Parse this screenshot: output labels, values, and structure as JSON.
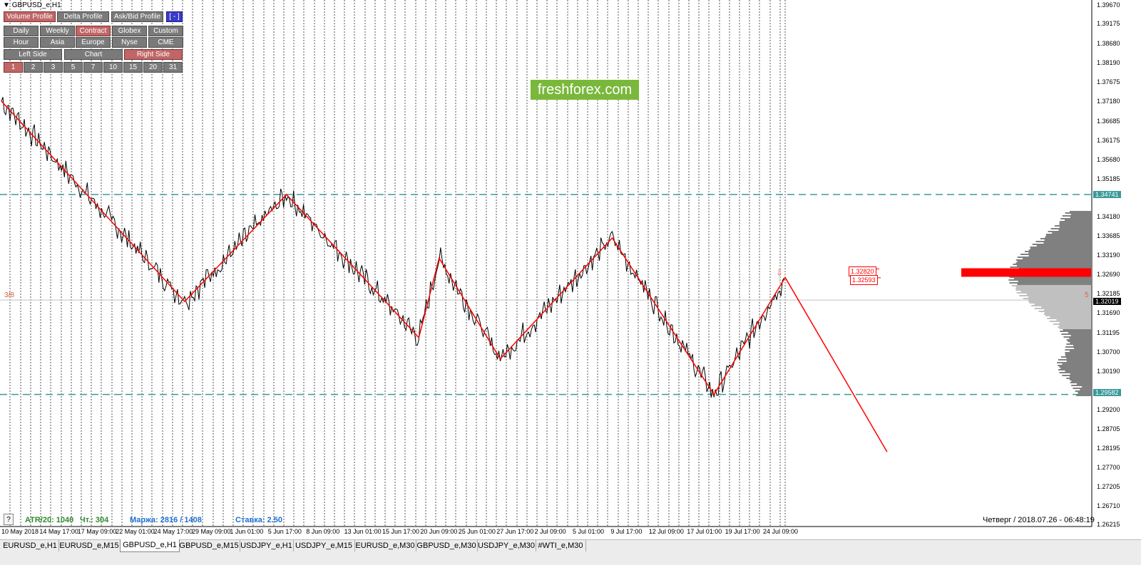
{
  "symbol_title": "GBPUSD_e,H1",
  "watermark": "freshforex.com",
  "panel": {
    "row1": [
      {
        "label": "Volume Profile",
        "state": "on"
      },
      {
        "label": "Delta Profile",
        "state": "off"
      },
      {
        "label": "Ask/Bid Profile",
        "state": "off"
      },
      {
        "label": "[ - ]",
        "state": "blue"
      }
    ],
    "row2": [
      {
        "label": "Daily",
        "state": "off"
      },
      {
        "label": "Weekly",
        "state": "off"
      },
      {
        "label": "Contract",
        "state": "on"
      },
      {
        "label": "Globex",
        "state": "off"
      },
      {
        "label": "Custom",
        "state": "off"
      }
    ],
    "row3": [
      {
        "label": "Hour",
        "state": "off"
      },
      {
        "label": "Asia",
        "state": "off"
      },
      {
        "label": "Europe",
        "state": "off"
      },
      {
        "label": "Nyse",
        "state": "off"
      },
      {
        "label": "CME",
        "state": "off"
      }
    ],
    "row4": [
      {
        "label": "Left Side",
        "state": "off"
      },
      {
        "label": "Chart",
        "state": "off"
      },
      {
        "label": "Right Side",
        "state": "on"
      }
    ],
    "row5": [
      {
        "label": "1",
        "state": "on"
      },
      {
        "label": "2",
        "state": "off"
      },
      {
        "label": "3",
        "state": "off"
      },
      {
        "label": "5",
        "state": "off"
      },
      {
        "label": "7",
        "state": "off"
      },
      {
        "label": "10",
        "state": "off"
      },
      {
        "label": "15",
        "state": "off"
      },
      {
        "label": "20",
        "state": "off"
      },
      {
        "label": "31",
        "state": "off"
      }
    ]
  },
  "stats": {
    "question": "?",
    "atr": "ATR/20: 1040",
    "ticks": "Чт.: 304",
    "margin": "Маржа: 2816 / 1408",
    "rate": "Ставка: 2.50"
  },
  "datetime": "Четверг / 2018.07.26 - 06:48:19",
  "labels": {
    "left_fraction": "3/8",
    "right_fraction": "5",
    "arrow": "⇩"
  },
  "level_tags": [
    "1.32820",
    "1.32593"
  ],
  "price_axis": [
    "1.39670",
    "1.39175",
    "1.38680",
    "1.38190",
    "1.37675",
    "1.37180",
    "1.36685",
    "1.36175",
    "1.35680",
    "1.35185",
    "1.34741",
    "1.34180",
    "1.33685",
    "1.33190",
    "1.32690",
    "1.32185",
    "1.32019",
    "1.31690",
    "1.31195",
    "1.30700",
    "1.30190",
    "1.29582",
    "1.29200",
    "1.28705",
    "1.28195",
    "1.27700",
    "1.27205",
    "1.26710",
    "1.26215"
  ],
  "highlight_prices": {
    "upper": "1.34741",
    "current": "1.32019",
    "lower": "1.29582"
  },
  "time_axis": [
    "10 May 2018",
    "14 May 17:00",
    "17 May 09:00",
    "22 May 01:00",
    "24 May 17:00",
    "29 May 09:00",
    "1 Jun 01:00",
    "5 Jun 17:00",
    "8 Jun 09:00",
    "13 Jun 01:00",
    "15 Jun 17:00",
    "20 Jun 09:00",
    "25 Jun 01:00",
    "27 Jun 17:00",
    "2 Jul 09:00",
    "5 Jul 01:00",
    "9 Jul 17:00",
    "12 Jul 09:00",
    "17 Jul 01:00",
    "19 Jul 17:00",
    "24 Jul 09:00"
  ],
  "tabs": [
    {
      "label": "EURUSD_e,H1",
      "active": false
    },
    {
      "label": "EURUSD_e,M15",
      "active": false
    },
    {
      "label": "GBPUSD_e,H1",
      "active": true
    },
    {
      "label": "GBPUSD_e,M15",
      "active": false
    },
    {
      "label": "USDJPY_e,H1",
      "active": false
    },
    {
      "label": "USDJPY_e,M15",
      "active": false
    },
    {
      "label": "EURUSD_e,M30",
      "active": false
    },
    {
      "label": "GBPUSD_e,M30",
      "active": false
    },
    {
      "label": "USDJPY_e,M30",
      "active": false
    },
    {
      "label": "#WTI_e,M30",
      "active": false
    }
  ],
  "colors": {
    "zigzag": "#ff0000",
    "level_dash": "#3a9a9a",
    "volume_profile": "#808080",
    "poc": "#ff0000",
    "atr_text": "#2e8b2e",
    "margin_text": "#1e6fd0",
    "tag_border": "#ff0000"
  },
  "chart_data": {
    "type": "line",
    "series": "GBPUSD_e,H1",
    "zigzag_pivots": [
      {
        "date": "2018-05-10",
        "price": 1.3715
      },
      {
        "date": "2018-05-28",
        "price": 1.3198
      },
      {
        "date": "2018-06-07",
        "price": 1.3474
      },
      {
        "date": "2018-06-20",
        "price": 1.3105
      },
      {
        "date": "2018-06-22",
        "price": 1.331
      },
      {
        "date": "2018-06-28",
        "price": 1.305
      },
      {
        "date": "2018-07-09",
        "price": 1.3362
      },
      {
        "date": "2018-07-19",
        "price": 1.2958
      },
      {
        "date": "2018-07-26",
        "price": 1.326
      },
      {
        "date": "2018-08-05",
        "price": 1.281
      }
    ],
    "ylim": [
      1.2621,
      1.3967
    ]
  }
}
